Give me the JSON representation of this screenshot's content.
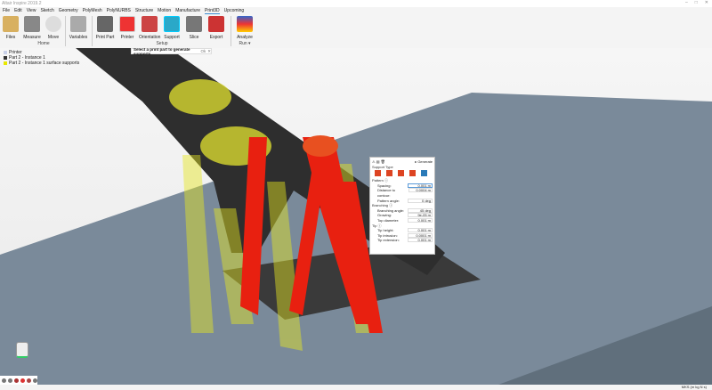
{
  "window": {
    "title": "Altair Inspire 2019.2",
    "controls": [
      "–",
      "□",
      "✕"
    ]
  },
  "menu": [
    "File",
    "Edit",
    "View",
    "Sketch",
    "Geometry",
    "PolyMesh",
    "PolyNURBS",
    "Structure",
    "Motion",
    "Manufacture",
    "Print3D",
    "Upcoming"
  ],
  "ribbon": {
    "tools": [
      {
        "label": "Files"
      },
      {
        "label": "Measure"
      },
      {
        "label": "Move"
      },
      {
        "label": "Variables"
      },
      {
        "label": "Print Part"
      },
      {
        "label": "Printer"
      },
      {
        "label": "Orientation"
      },
      {
        "label": "Support"
      },
      {
        "label": "Slice"
      },
      {
        "label": "Export"
      },
      {
        "label": "Analyze"
      }
    ],
    "groups": [
      "Home",
      "Setup",
      "Run ▾"
    ]
  },
  "tooltip": {
    "text": "Select a print part to generate supports.",
    "ok": "Ok",
    "close": "✕"
  },
  "legend": [
    {
      "label": "Printer",
      "color": "#c8d0e8"
    },
    {
      "label": "Part 2 - Instance 1",
      "color": "#333333"
    },
    {
      "label": "Part 2 - Instance 1 surface supports",
      "color": "#e8e800"
    }
  ],
  "panel": {
    "generate": "▸ Generate",
    "support_type": "Support Type",
    "pattern": "Pattern ⓘ",
    "fields1": [
      {
        "label": "Spacing:",
        "value": "0.001 m"
      },
      {
        "label": "Distance to contour:",
        "value": "0.0004 m"
      },
      {
        "label": "Pattern angle:",
        "value": "0 deg"
      }
    ],
    "branching": "Branching ⓘ",
    "fields2": [
      {
        "label": "Branching angle:",
        "value": "45 deg"
      },
      {
        "label": "Growing:",
        "value": "9e-05 m"
      },
      {
        "label": "Top diameter:",
        "value": "0.001 m"
      }
    ],
    "tip": "Tip ⓘ",
    "fields3": [
      {
        "label": "Tip height:",
        "value": "0.001 m"
      },
      {
        "label": "Tip intrusion:",
        "value": "0.0001 m"
      },
      {
        "label": "Tip extension:",
        "value": "0.001 m"
      }
    ]
  },
  "status": {
    "units": "MKS (m kg N s)"
  }
}
